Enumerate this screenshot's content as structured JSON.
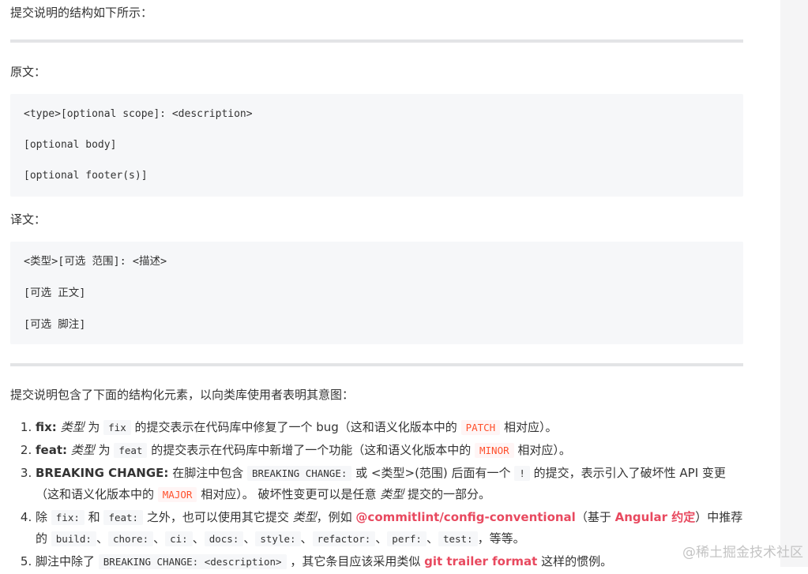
{
  "intro": "提交说明的结构如下所示：",
  "original_label": "原文：",
  "original_code": [
    "<type>[optional scope]: <description>",
    "[optional body]",
    "[optional footer(s)]"
  ],
  "translation_label": "译文：",
  "translation_code": [
    "<类型>[可选 范围]: <描述>",
    "[可选 正文]",
    "[可选 脚注]"
  ],
  "elements_intro": "提交说明包含了下面的结构化元素，以向类库使用者表明其意图：",
  "items": {
    "fix": {
      "key": "fix:",
      "type_em": "类型",
      "wei": " 为 ",
      "code1": "fix",
      "rest1": " 的提交表示在代码库中修复了一个 bug（这和语义化版本中的 ",
      "code2": "PATCH",
      "rest2": " 相对应）。"
    },
    "feat": {
      "key": "feat:",
      "type_em": "类型",
      "wei": " 为 ",
      "code1": "feat",
      "rest1": " 的提交表示在代码库中新增了一个功能（这和语义化版本中的 ",
      "code2": "MINOR",
      "rest2": " 相对应）。"
    },
    "breaking": {
      "key": "BREAKING CHANGE:",
      "t1": " 在脚注中包含 ",
      "code1": "BREAKING CHANGE:",
      "t2": " 或 <类型>(范围) 后面有一个 ",
      "code2": "!",
      "t3": " 的提交，表示引入了破坏性 API 变更（这和语义化版本中的 ",
      "code3": "MAJOR",
      "t4": " 相对应）。 破坏性变更可以是任意 ",
      "type_em": "类型",
      "t5": " 提交的一部分。"
    },
    "other": {
      "t1": "除 ",
      "code1": "fix:",
      "t2": " 和 ",
      "code2": "feat:",
      "t3": " 之外，也可以使用其它提交 ",
      "type_em": "类型",
      "t4": "，例如 ",
      "link1": "@commitlint/config-conventional",
      "t5": "（基于 ",
      "link2": "Angular 约定",
      "t6": "）中推荐的 ",
      "codes": [
        "build:",
        "chore:",
        "ci:",
        "docs:",
        "style:",
        "refactor:",
        "perf:",
        "test:"
      ],
      "sep": "、",
      "t7": "，等等。"
    },
    "footer": {
      "t1": "脚注中除了 ",
      "code1": "BREAKING CHANGE: <description>",
      "t2": " ，其它条目应该采用类似 ",
      "link1": "git trailer format",
      "t3": " 这样的惯例。"
    }
  },
  "watermark": "@稀土掘金技术社区",
  "colors": {
    "code_red": "#ff502c",
    "link": "#e8495f",
    "code_bg": "#f6f7f9",
    "hr": "#e3e4e6"
  }
}
